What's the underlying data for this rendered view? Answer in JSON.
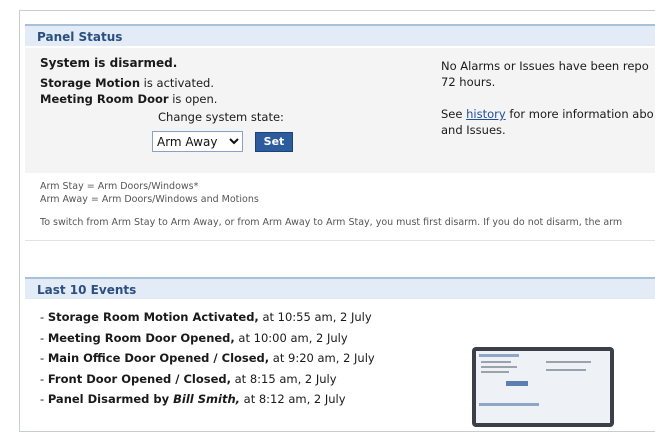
{
  "panel_status": {
    "heading": "Panel Status",
    "system_state": "System is disarmed.",
    "motion_name": "Storage Motion",
    "motion_state": " is activated.",
    "door_name": "Meeting Room Door",
    "door_state": " is open.",
    "change_label": "Change system state:",
    "selected_option": "Arm Away",
    "set_label": "Set",
    "alarms_line1": "No Alarms or Issues have been repo",
    "alarms_line2": "72 hours.",
    "see_prefix": "See ",
    "history_link": "history",
    "see_suffix": " for more information abo",
    "see_line2": "and Issues.",
    "note_stay": "Arm Stay = Arm Doors/Windows*",
    "note_away": "Arm Away = Arm Doors/Windows and Motions",
    "switch_note": "To switch from Arm Stay to Arm Away, or from Arm Away to Arm Stay, you must first disarm. If you do not disarm, the arm"
  },
  "events": {
    "heading": "Last 10 Events",
    "items": [
      {
        "prefix": "- ",
        "title": "Storage Room Motion Activated,",
        "by": "",
        "time": " at 10:55 am, 2 July"
      },
      {
        "prefix": "- ",
        "title": "Meeting Room Door Opened,",
        "by": "",
        "time": " at 10:00 am, 2 July"
      },
      {
        "prefix": "- ",
        "title": "Main Office Door Opened / Closed,",
        "by": "",
        "time": " at 9:20 am, 2 July"
      },
      {
        "prefix": "- ",
        "title": "Front Door Opened / Closed,",
        "by": "",
        "time": " at 8:15 am, 2 July"
      },
      {
        "prefix": "- ",
        "title": "Panel Disarmed by ",
        "by": "Bill Smith,",
        "time": " at 8:12 am, 2 July"
      }
    ]
  },
  "colors": {
    "header_bg": "#e3ecf6",
    "header_text": "#2b4f80",
    "button_bg": "#2c5b9e",
    "link": "#1f4f9a"
  }
}
